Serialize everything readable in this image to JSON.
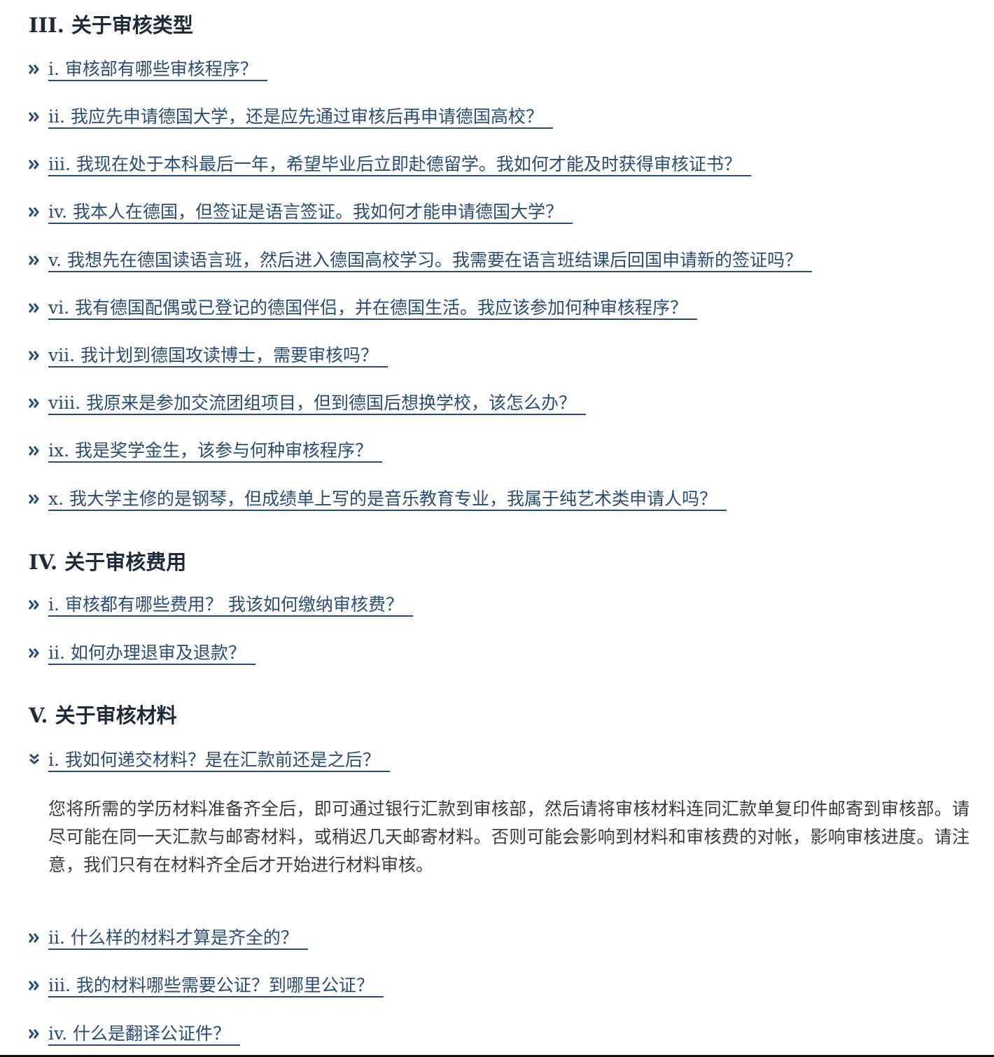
{
  "sections": [
    {
      "title": "III. 关于审核类型",
      "items": [
        {
          "label": "i. 审核部有哪些审核程序？"
        },
        {
          "label": "ii. 我应先申请德国大学，还是应先通过审核后再申请德国高校？"
        },
        {
          "label": "iii. 我现在处于本科最后一年，希望毕业后立即赴德留学。我如何才能及时获得审核证书？"
        },
        {
          "label": "iv. 我本人在德国，但签证是语言签证。我如何才能申请德国大学？"
        },
        {
          "label": "v. 我想先在德国读语言班，然后进入德国高校学习。我需要在语言班结课后回国申请新的签证吗？"
        },
        {
          "label": "vi. 我有德国配偶或已登记的德国伴侣，并在德国生活。我应该参加何种审核程序？"
        },
        {
          "label": "vii. 我计划到德国攻读博士，需要审核吗？"
        },
        {
          "label": "viii. 我原来是参加交流团组项目，但到德国后想换学校，该怎么办？"
        },
        {
          "label": "ix. 我是奖学金生，该参与何种审核程序？"
        },
        {
          "label": "x. 我大学主修的是钢琴，但成绩单上写的是音乐教育专业，我属于纯艺术类申请人吗？"
        }
      ]
    },
    {
      "title": "IV. 关于审核费用",
      "items": [
        {
          "label": "i. 审核都有哪些费用？ 我该如何缴纳审核费？"
        },
        {
          "label": "ii. 如何办理退审及退款？"
        }
      ]
    },
    {
      "title": "V. 关于审核材料",
      "items": [
        {
          "label": "i. 我如何递交材料？是在汇款前还是之后？",
          "expanded": true,
          "answer": "您将所需的学历材料准备齐全后，即可通过银行汇款到审核部，然后请将审核材料连同汇款单复印件邮寄到审核部。请尽可能在同一天汇款与邮寄材料，或稍迟几天邮寄材料。否则可能会影响到材料和审核费的对帐，影响审核进度。请注意，我们只有在材料齐全后才开始进行材料审核。"
        },
        {
          "label": "ii. 什么样的材料才算是齐全的？"
        },
        {
          "label": "iii. 我的材料哪些需要公证？到哪里公证？"
        },
        {
          "label": "iv. 什么是翻译公证件？"
        }
      ]
    }
  ],
  "icons": {
    "collapsed": "double-chevron-right-icon",
    "expanded": "double-chevron-down-icon"
  },
  "colors": {
    "link": "#294d75",
    "heading": "#1c2a3a",
    "body_text": "#3b3b3b"
  }
}
